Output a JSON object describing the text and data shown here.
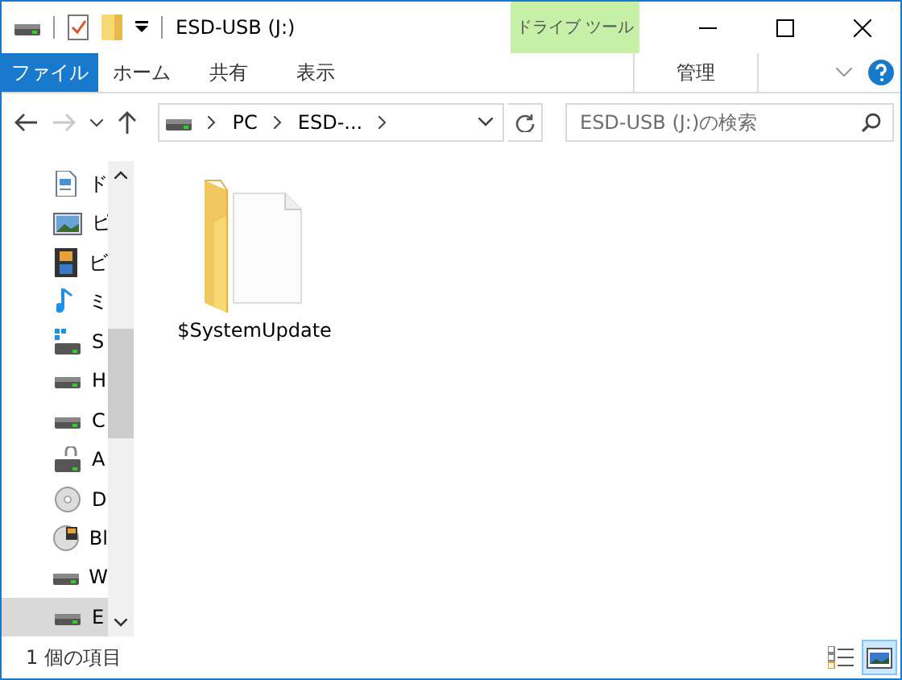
{
  "window": {
    "title": "ESD-USB (J:)",
    "context_tab_group": "ドライブ ツール"
  },
  "ribbon_tabs": [
    {
      "label": "ファイル",
      "kind": "file"
    },
    {
      "label": "ホーム",
      "kind": "normal"
    },
    {
      "label": "共有",
      "kind": "normal"
    },
    {
      "label": "表示",
      "kind": "normal"
    },
    {
      "label": "管理",
      "kind": "context"
    }
  ],
  "navigation": {
    "forward_disabled": true,
    "breadcrumbs": [
      "PC",
      "ESD-..."
    ]
  },
  "search": {
    "placeholder": "ESD-USB (J:)の検索"
  },
  "sidebar": {
    "items": [
      {
        "label": "ド",
        "kind": "document",
        "selected": false
      },
      {
        "label": "ピ",
        "kind": "picture",
        "selected": false
      },
      {
        "label": "ビ",
        "kind": "video",
        "selected": false
      },
      {
        "label": "ミ",
        "kind": "music",
        "selected": false
      },
      {
        "label": "S",
        "kind": "network-drive",
        "selected": false
      },
      {
        "label": "H",
        "kind": "drive",
        "selected": false
      },
      {
        "label": "C",
        "kind": "drive",
        "selected": false
      },
      {
        "label": "A",
        "kind": "locked-drive",
        "selected": false
      },
      {
        "label": "D",
        "kind": "disc",
        "selected": false
      },
      {
        "label": "Bl",
        "kind": "media-disc",
        "selected": false
      },
      {
        "label": "W",
        "kind": "drive",
        "selected": false
      },
      {
        "label": "E",
        "kind": "drive",
        "selected": true
      }
    ]
  },
  "files": [
    {
      "name": "$SystemUpdate",
      "kind": "folder"
    }
  ],
  "status_bar": {
    "item_count": "1 個の項目",
    "views": [
      {
        "kind": "details",
        "selected": false
      },
      {
        "kind": "large-icons",
        "selected": true
      }
    ]
  }
}
